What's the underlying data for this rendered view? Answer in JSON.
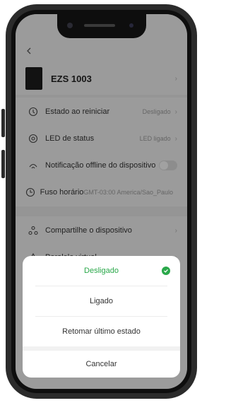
{
  "header": {
    "back_icon": "chevron-left-icon"
  },
  "device": {
    "name": "EZS 1003",
    "thumb_icon": "device-thumbnail"
  },
  "settings": [
    {
      "label": "Estado ao reiniciar",
      "value": "Desligado",
      "icon": "power-restart-icon"
    },
    {
      "label": "LED de status",
      "value": "LED ligado",
      "icon": "led-icon"
    },
    {
      "label": "Notificação offline do dispositivo",
      "value": "",
      "icon": "offline-notification-icon",
      "toggle": false
    },
    {
      "label": "Fuso horário",
      "value": "GMT-03:00 America/Sao_Paulo",
      "icon": "timezone-icon"
    }
  ],
  "share": [
    {
      "label": "Compartilhe o dispositivo",
      "icon": "share-icon"
    },
    {
      "label": "Paralelo virtual",
      "icon": "virtual-parallel-icon"
    }
  ],
  "sheet": {
    "options": [
      {
        "label": "Desligado",
        "selected": true
      },
      {
        "label": "Ligado",
        "selected": false
      },
      {
        "label": "Retomar último estado",
        "selected": false
      }
    ],
    "cancel": "Cancelar",
    "accent": "#2aa84a"
  }
}
